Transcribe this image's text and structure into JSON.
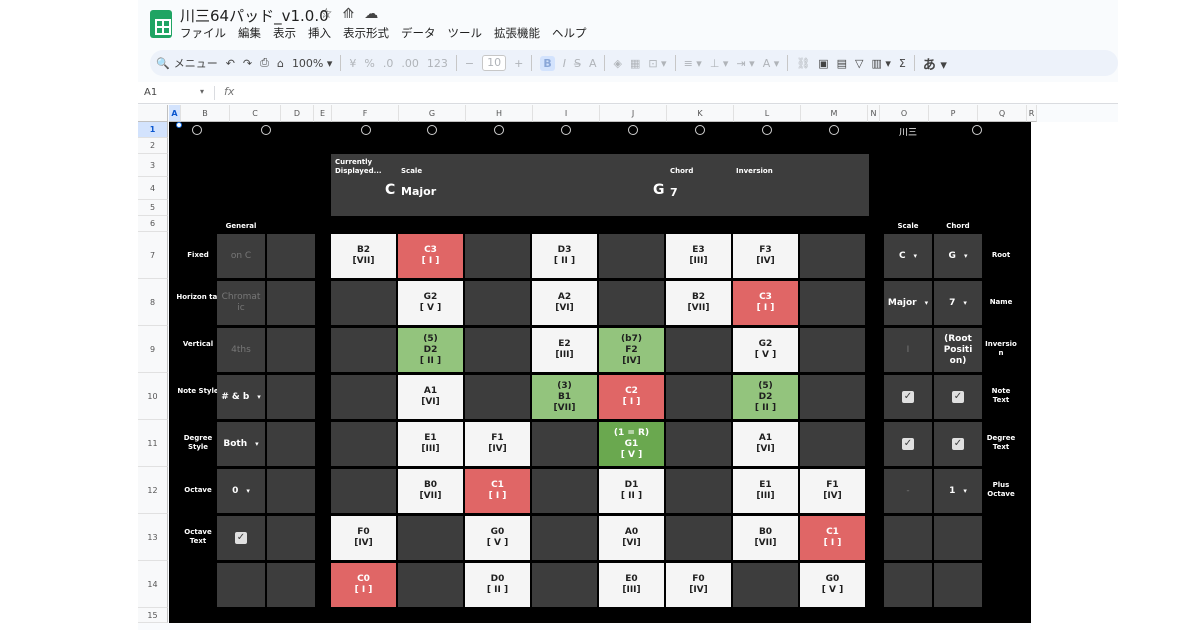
{
  "header": {
    "doc_title": "川三64パッド_v1.0.0",
    "menu": [
      "ファイル",
      "編集",
      "表示",
      "挿入",
      "表示形式",
      "データ",
      "ツール",
      "拡張機能",
      "ヘルプ"
    ]
  },
  "toolbar": {
    "search_label": "メニュー",
    "zoom": "100%",
    "font_size": "10",
    "currency": "¥",
    "percent": "%",
    "decimal_dec": ".0",
    "decimal_inc": ".00",
    "number_format": "123",
    "bold": "B",
    "italic": "I",
    "ime": "あ"
  },
  "formula_bar": {
    "cell_ref": "A1",
    "fx": "fx"
  },
  "columns": [
    "A",
    "B",
    "C",
    "D",
    "E",
    "F",
    "G",
    "H",
    "I",
    "J",
    "K",
    "L",
    "M",
    "N",
    "O",
    "P",
    "Q",
    "R"
  ],
  "rows": [
    "1",
    "2",
    "3",
    "4",
    "5",
    "6",
    "7",
    "8",
    "9",
    "10",
    "11",
    "12",
    "13",
    "14",
    "15"
  ],
  "brand": "川三",
  "info": {
    "currently_line1": "Currently",
    "currently_line2": "Displayed...",
    "scale_label": "Scale",
    "chord_label": "Chord",
    "inversion_label": "Inversion",
    "root_note": "C",
    "scale_name": "Major",
    "chord_root": "G",
    "chord_quality": "7"
  },
  "general": {
    "header": "General",
    "labels": [
      "Fixed",
      "Horizon tal",
      "Vertical",
      "Note Style",
      "Degree Style",
      "Octave",
      "Octave Text"
    ],
    "values": [
      "on C",
      "Chromat ic",
      "4ths",
      "# & b",
      "Both",
      "0",
      ""
    ]
  },
  "pad_grid": [
    [
      {
        "t": "B2",
        "d": "[VII]",
        "c": "white"
      },
      {
        "t": "C3",
        "d": "[ I ]",
        "c": "red"
      },
      {
        "t": "",
        "d": "",
        "c": "dark"
      },
      {
        "t": "D3",
        "d": "[ II ]",
        "c": "white"
      },
      {
        "t": "",
        "d": "",
        "c": "dark"
      },
      {
        "t": "E3",
        "d": "[III]",
        "c": "white"
      },
      {
        "t": "F3",
        "d": "[IV]",
        "c": "white"
      },
      {
        "t": "",
        "d": "",
        "c": "dark"
      }
    ],
    [
      {
        "t": "",
        "d": "",
        "c": "dark"
      },
      {
        "t": "G2",
        "d": "[ V ]",
        "c": "white"
      },
      {
        "t": "",
        "d": "",
        "c": "dark"
      },
      {
        "t": "A2",
        "d": "[VI]",
        "c": "white"
      },
      {
        "t": "",
        "d": "",
        "c": "dark"
      },
      {
        "t": "B2",
        "d": "[VII]",
        "c": "white"
      },
      {
        "t": "C3",
        "d": "[ I ]",
        "c": "red"
      },
      {
        "t": "",
        "d": "",
        "c": "dark"
      }
    ],
    [
      {
        "t": "",
        "d": "",
        "c": "dark"
      },
      {
        "p": "(5)",
        "t": "D2",
        "d": "[ II ]",
        "c": "green"
      },
      {
        "t": "",
        "d": "",
        "c": "dark"
      },
      {
        "t": "E2",
        "d": "[III]",
        "c": "white"
      },
      {
        "p": "(b7)",
        "t": "F2",
        "d": "[IV]",
        "c": "green"
      },
      {
        "t": "",
        "d": "",
        "c": "dark"
      },
      {
        "t": "G2",
        "d": "[ V ]",
        "c": "white"
      },
      {
        "t": "",
        "d": "",
        "c": "dark"
      }
    ],
    [
      {
        "t": "",
        "d": "",
        "c": "dark"
      },
      {
        "t": "A1",
        "d": "[VI]",
        "c": "white"
      },
      {
        "t": "",
        "d": "",
        "c": "dark"
      },
      {
        "p": "(3)",
        "t": "B1",
        "d": "[VII]",
        "c": "green"
      },
      {
        "t": "C2",
        "d": "[ I ]",
        "c": "red"
      },
      {
        "t": "",
        "d": "",
        "c": "dark"
      },
      {
        "p": "(5)",
        "t": "D2",
        "d": "[ II ]",
        "c": "green"
      },
      {
        "t": "",
        "d": "",
        "c": "dark"
      }
    ],
    [
      {
        "t": "",
        "d": "",
        "c": "dark"
      },
      {
        "t": "E1",
        "d": "[III]",
        "c": "white"
      },
      {
        "t": "F1",
        "d": "[IV]",
        "c": "white"
      },
      {
        "t": "",
        "d": "",
        "c": "dark"
      },
      {
        "p": "(1 = R)",
        "t": "G1",
        "d": "[ V ]",
        "c": "green-dark"
      },
      {
        "t": "",
        "d": "",
        "c": "dark"
      },
      {
        "t": "A1",
        "d": "[VI]",
        "c": "white"
      },
      {
        "t": "",
        "d": "",
        "c": "dark"
      }
    ],
    [
      {
        "t": "",
        "d": "",
        "c": "dark"
      },
      {
        "t": "B0",
        "d": "[VII]",
        "c": "white"
      },
      {
        "t": "C1",
        "d": "[ I ]",
        "c": "red"
      },
      {
        "t": "",
        "d": "",
        "c": "dark"
      },
      {
        "t": "D1",
        "d": "[ II ]",
        "c": "white"
      },
      {
        "t": "",
        "d": "",
        "c": "dark"
      },
      {
        "t": "E1",
        "d": "[III]",
        "c": "white"
      },
      {
        "t": "F1",
        "d": "[IV]",
        "c": "white"
      }
    ],
    [
      {
        "t": "F0",
        "d": "[IV]",
        "c": "white"
      },
      {
        "t": "",
        "d": "",
        "c": "dark"
      },
      {
        "t": "G0",
        "d": "[ V ]",
        "c": "white"
      },
      {
        "t": "",
        "d": "",
        "c": "dark"
      },
      {
        "t": "A0",
        "d": "[VI]",
        "c": "white"
      },
      {
        "t": "",
        "d": "",
        "c": "dark"
      },
      {
        "t": "B0",
        "d": "[VII]",
        "c": "white"
      },
      {
        "t": "C1",
        "d": "[ I ]",
        "c": "red"
      }
    ],
    [
      {
        "t": "C0",
        "d": "[ I ]",
        "c": "red"
      },
      {
        "t": "",
        "d": "",
        "c": "dark"
      },
      {
        "t": "D0",
        "d": "[ II ]",
        "c": "white"
      },
      {
        "t": "",
        "d": "",
        "c": "dark"
      },
      {
        "t": "E0",
        "d": "[III]",
        "c": "white"
      },
      {
        "t": "F0",
        "d": "[IV]",
        "c": "white"
      },
      {
        "t": "",
        "d": "",
        "c": "dark"
      },
      {
        "t": "G0",
        "d": "[ V ]",
        "c": "white"
      }
    ]
  ],
  "settings": {
    "scale_header": "Scale",
    "chord_header": "Chord",
    "labels": [
      "Root",
      "Name",
      "Inversio n",
      "Note Text",
      "Degree Text",
      "Plus Octave"
    ],
    "scale_values": [
      "C",
      "Major",
      "I",
      "",
      "",
      "-"
    ],
    "chord_values": [
      "G",
      "7",
      "(Root Positi on)",
      "",
      "",
      "1"
    ]
  },
  "colors": {
    "dark_cell": "#3d3d3d",
    "red_cell": "#e06666",
    "green_cell": "#93c47d",
    "green_dark_cell": "#6aa84f",
    "white_cell": "#f5f5f5",
    "sheets_green": "#1fa463"
  }
}
